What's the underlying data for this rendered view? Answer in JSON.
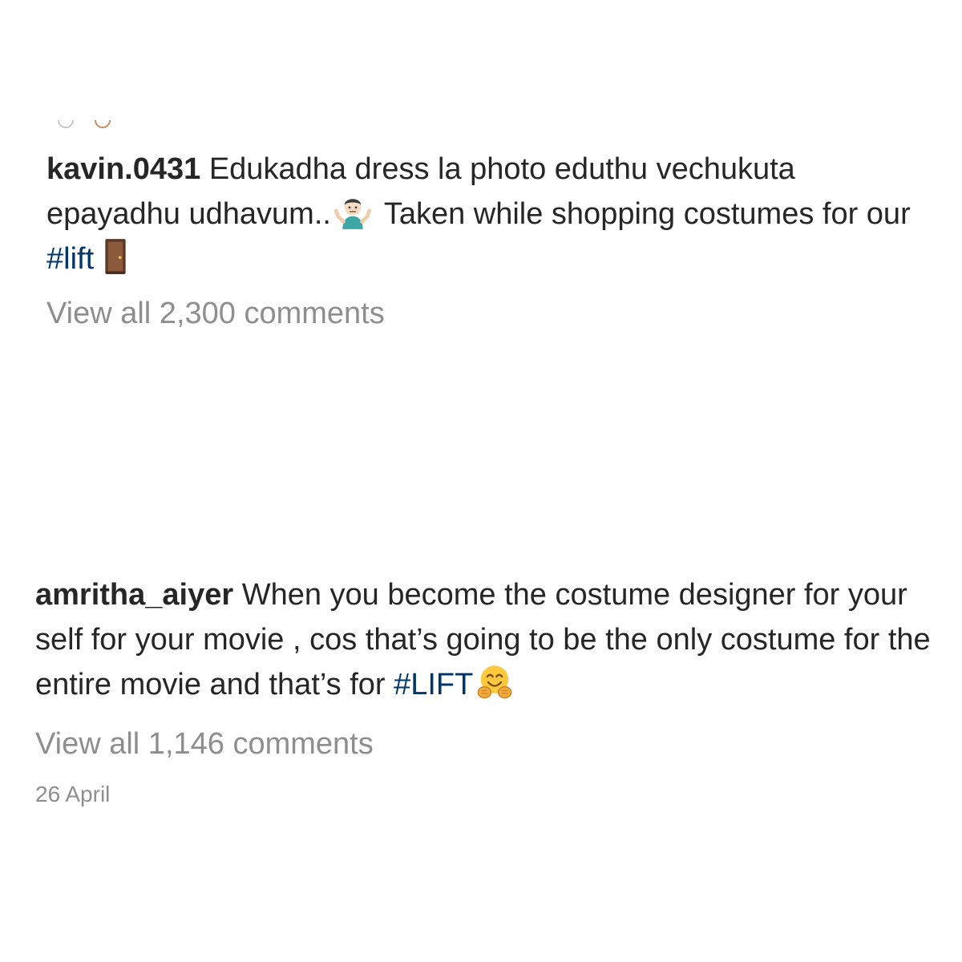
{
  "posts": [
    {
      "username": "kavin.0431",
      "caption_part1": "Edukadha dress la photo eduthu vechukuta epayadhu udhavum..",
      "emoji1": "person-shrugging",
      "caption_part2": "Taken while shopping costumes for our",
      "hashtag": "#lift",
      "emoji2": "door",
      "view_comments": "View all 2,300 comments"
    },
    {
      "username": "amritha_aiyer",
      "caption_part1": "When you become the costume designer for your self for your movie , cos that’s going to be the only costume for the entire movie and that’s for",
      "hashtag": "#LIFT",
      "emoji1": "hugging-face",
      "view_comments": "View all 1,146 comments",
      "timestamp": "26 April"
    }
  ]
}
